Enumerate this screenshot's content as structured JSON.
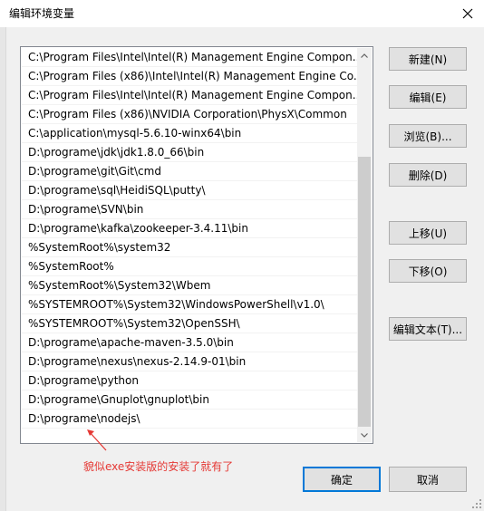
{
  "window": {
    "title": "编辑环境变量"
  },
  "paths": [
    "C:\\Program Files\\Intel\\Intel(R) Management Engine Compon...",
    "C:\\Program Files (x86)\\Intel\\Intel(R) Management Engine Co...",
    "C:\\Program Files\\Intel\\Intel(R) Management Engine Compon...",
    "C:\\Program Files (x86)\\NVIDIA Corporation\\PhysX\\Common",
    "C:\\application\\mysql-5.6.10-winx64\\bin",
    "D:\\programe\\jdk\\jdk1.8.0_66\\bin",
    "D:\\programe\\git\\Git\\cmd",
    "D:\\programe\\sql\\HeidiSQL\\putty\\",
    "D:\\programe\\SVN\\bin",
    "D:\\programe\\kafka\\zookeeper-3.4.11\\bin",
    "%SystemRoot%\\system32",
    "%SystemRoot%",
    "%SystemRoot%\\System32\\Wbem",
    "%SYSTEMROOT%\\System32\\WindowsPowerShell\\v1.0\\",
    "%SYSTEMROOT%\\System32\\OpenSSH\\",
    "D:\\programe\\apache-maven-3.5.0\\bin",
    "D:\\programe\\nexus\\nexus-2.14.9-01\\bin",
    "D:\\programe\\python",
    "D:\\programe\\Gnuplot\\gnuplot\\bin",
    "D:\\programe\\nodejs\\"
  ],
  "buttons": {
    "new": "新建(N)",
    "edit": "编辑(E)",
    "browse": "浏览(B)...",
    "delete": "删除(D)",
    "move_up": "上移(U)",
    "move_down": "下移(O)",
    "edit_text": "编辑文本(T)...",
    "ok": "确定",
    "cancel": "取消"
  },
  "annotation": {
    "text": "貌似exe安装版的安装了就有了",
    "color": "#e53935"
  },
  "colors": {
    "default_button_border": "#0078d7",
    "button_bg": "#e1e1e1"
  }
}
